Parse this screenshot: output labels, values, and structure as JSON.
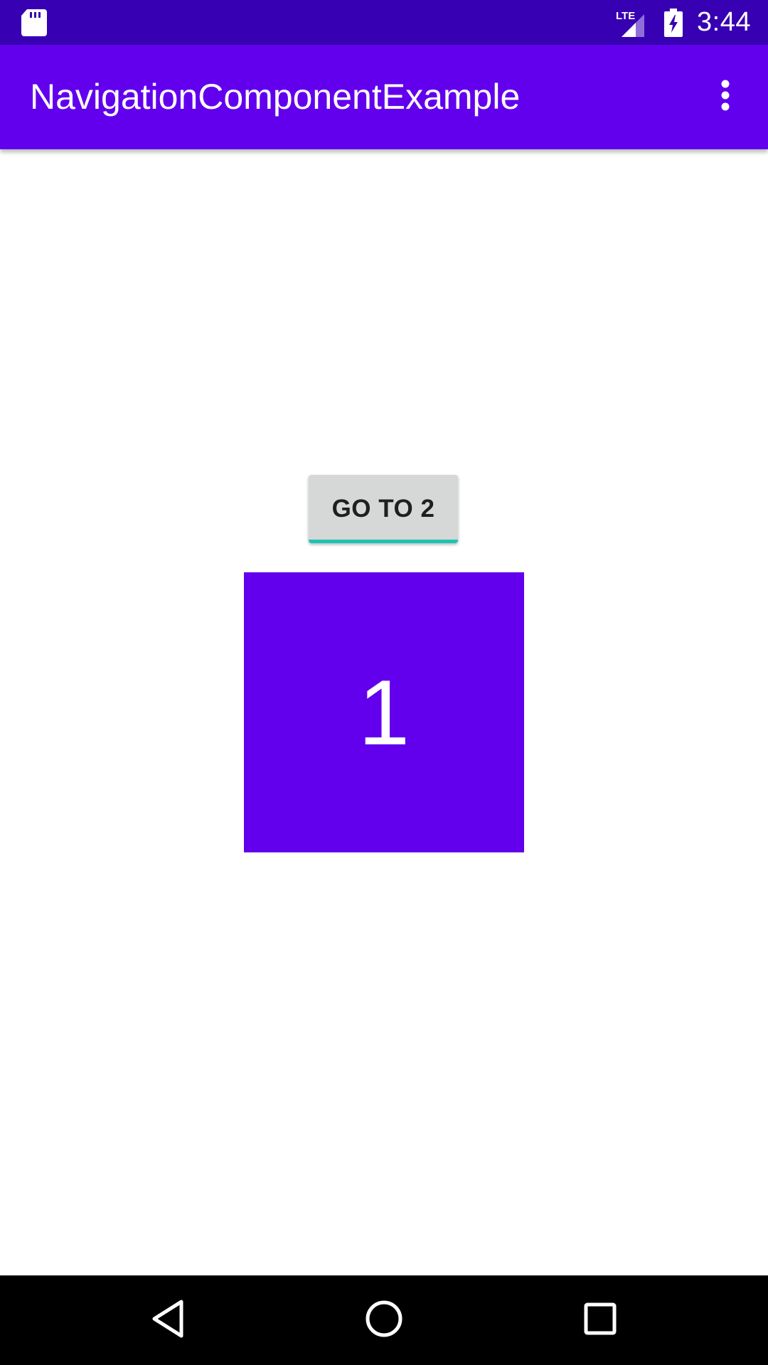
{
  "status_bar": {
    "time": "3:44",
    "network_label": "LTE",
    "icons": [
      "sd-card-icon",
      "lte-signal-icon",
      "battery-charging-icon"
    ],
    "background_color": "#3700b3"
  },
  "app_bar": {
    "title": "NavigationComponentExample",
    "menu_icon": "more-vert-icon",
    "background_color": "#6200ee"
  },
  "main": {
    "navigate_button_label": "GO TO 2",
    "number_box_label": "1",
    "number_box_color": "#6200ee",
    "focus_accent_color": "#1bc4b5"
  },
  "nav_bar": {
    "buttons": [
      {
        "name": "back",
        "icon": "back-triangle-icon"
      },
      {
        "name": "home",
        "icon": "home-circle-icon"
      },
      {
        "name": "recents",
        "icon": "recents-square-icon"
      }
    ]
  }
}
